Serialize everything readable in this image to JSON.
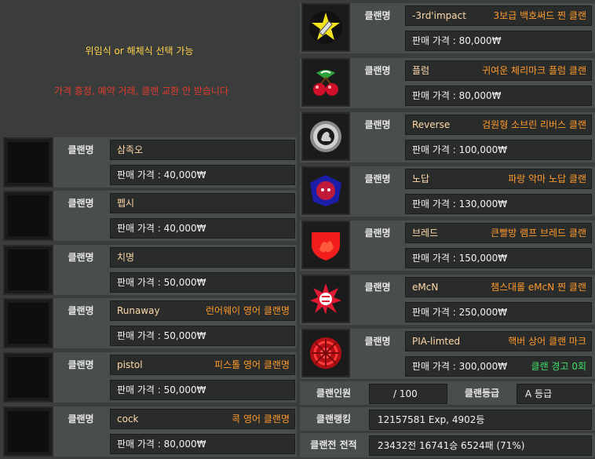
{
  "notice": {
    "line1": "위임식 or 해체식 선택 가능",
    "line2": "가격 흥정, 예약 거래, 클랜 교환 안 받습니다"
  },
  "labels": {
    "clan_name": "클랜명",
    "clan_members": "클랜인원",
    "clan_grade": "클랜등급",
    "clan_ranking": "클랜랭킹",
    "clan_record": "클랜전 전적"
  },
  "left_listings": [
    {
      "name": "삼족오",
      "desc": "",
      "price": "판매 가격 : 40,000₩"
    },
    {
      "name": "펩시",
      "desc": "",
      "price": "판매 가격 : 40,000₩"
    },
    {
      "name": "치명",
      "desc": "",
      "price": "판매 가격 : 50,000₩"
    },
    {
      "name": "Runaway",
      "desc": "런어웨이 영어 클랜명",
      "price": "판매 가격 : 50,000₩"
    },
    {
      "name": "pistol",
      "desc": "피스톨 영어 클랜명",
      "price": "판매 가격 : 50,000₩"
    },
    {
      "name": "cock",
      "desc": "콕 영어 클랜명",
      "price": "판매 가격 : 80,000₩"
    }
  ],
  "right_listings": [
    {
      "name": "-3rd'impact",
      "desc": "3보급 백호써드 찐 클랜",
      "price": "판매 가격 : 80,000₩",
      "icon": "yellow-star-emblem-icon",
      "extra": ""
    },
    {
      "name": "플럼",
      "desc": "귀여운 체리마크 플럼 클랜",
      "price": "판매 가격 : 80,000₩",
      "icon": "cherry-emblem-icon",
      "extra": ""
    },
    {
      "name": "Reverse",
      "desc": "검원형 소브린 리버스 클랜",
      "price": "판매 가격 : 100,000₩",
      "icon": "lion-badge-icon",
      "extra": ""
    },
    {
      "name": "노답",
      "desc": "파랑 악마 노답 클랜",
      "price": "판매 가격 : 130,000₩",
      "icon": "blue-devil-emblem-icon",
      "extra": ""
    },
    {
      "name": "브레드",
      "desc": "큰빨방 램프 브레드 클랜",
      "price": "판매 가격 : 150,000₩",
      "icon": "red-shield-icon",
      "extra": ""
    },
    {
      "name": "eMcN",
      "desc": "챔스대롤 eMcN 찐 클랜",
      "price": "판매 가격 : 250,000₩",
      "icon": "red-burst-emblem-icon",
      "extra": ""
    },
    {
      "name": "PIA-limted",
      "desc": "핵버 상어 클랜 마크",
      "price": "판매 가격 : 300,000₩",
      "icon": "red-wheel-emblem-icon",
      "extra": "클랜 경고 0회"
    }
  ],
  "stats": {
    "members_value": "/ 100",
    "grade_value": "A 등급",
    "ranking_value": "12157581 Exp,  4902등",
    "record_value": "23432전 16741승 6524패 (71%)"
  },
  "colors": {
    "background": "#3b3d3d",
    "field": "#2a2c2c",
    "name_text": "#ffd9a8",
    "desc_text": "#ff9a2a",
    "warning_text": "#3fe06a",
    "notice_yellow": "#ffd24a",
    "notice_red": "#e03a2c"
  }
}
